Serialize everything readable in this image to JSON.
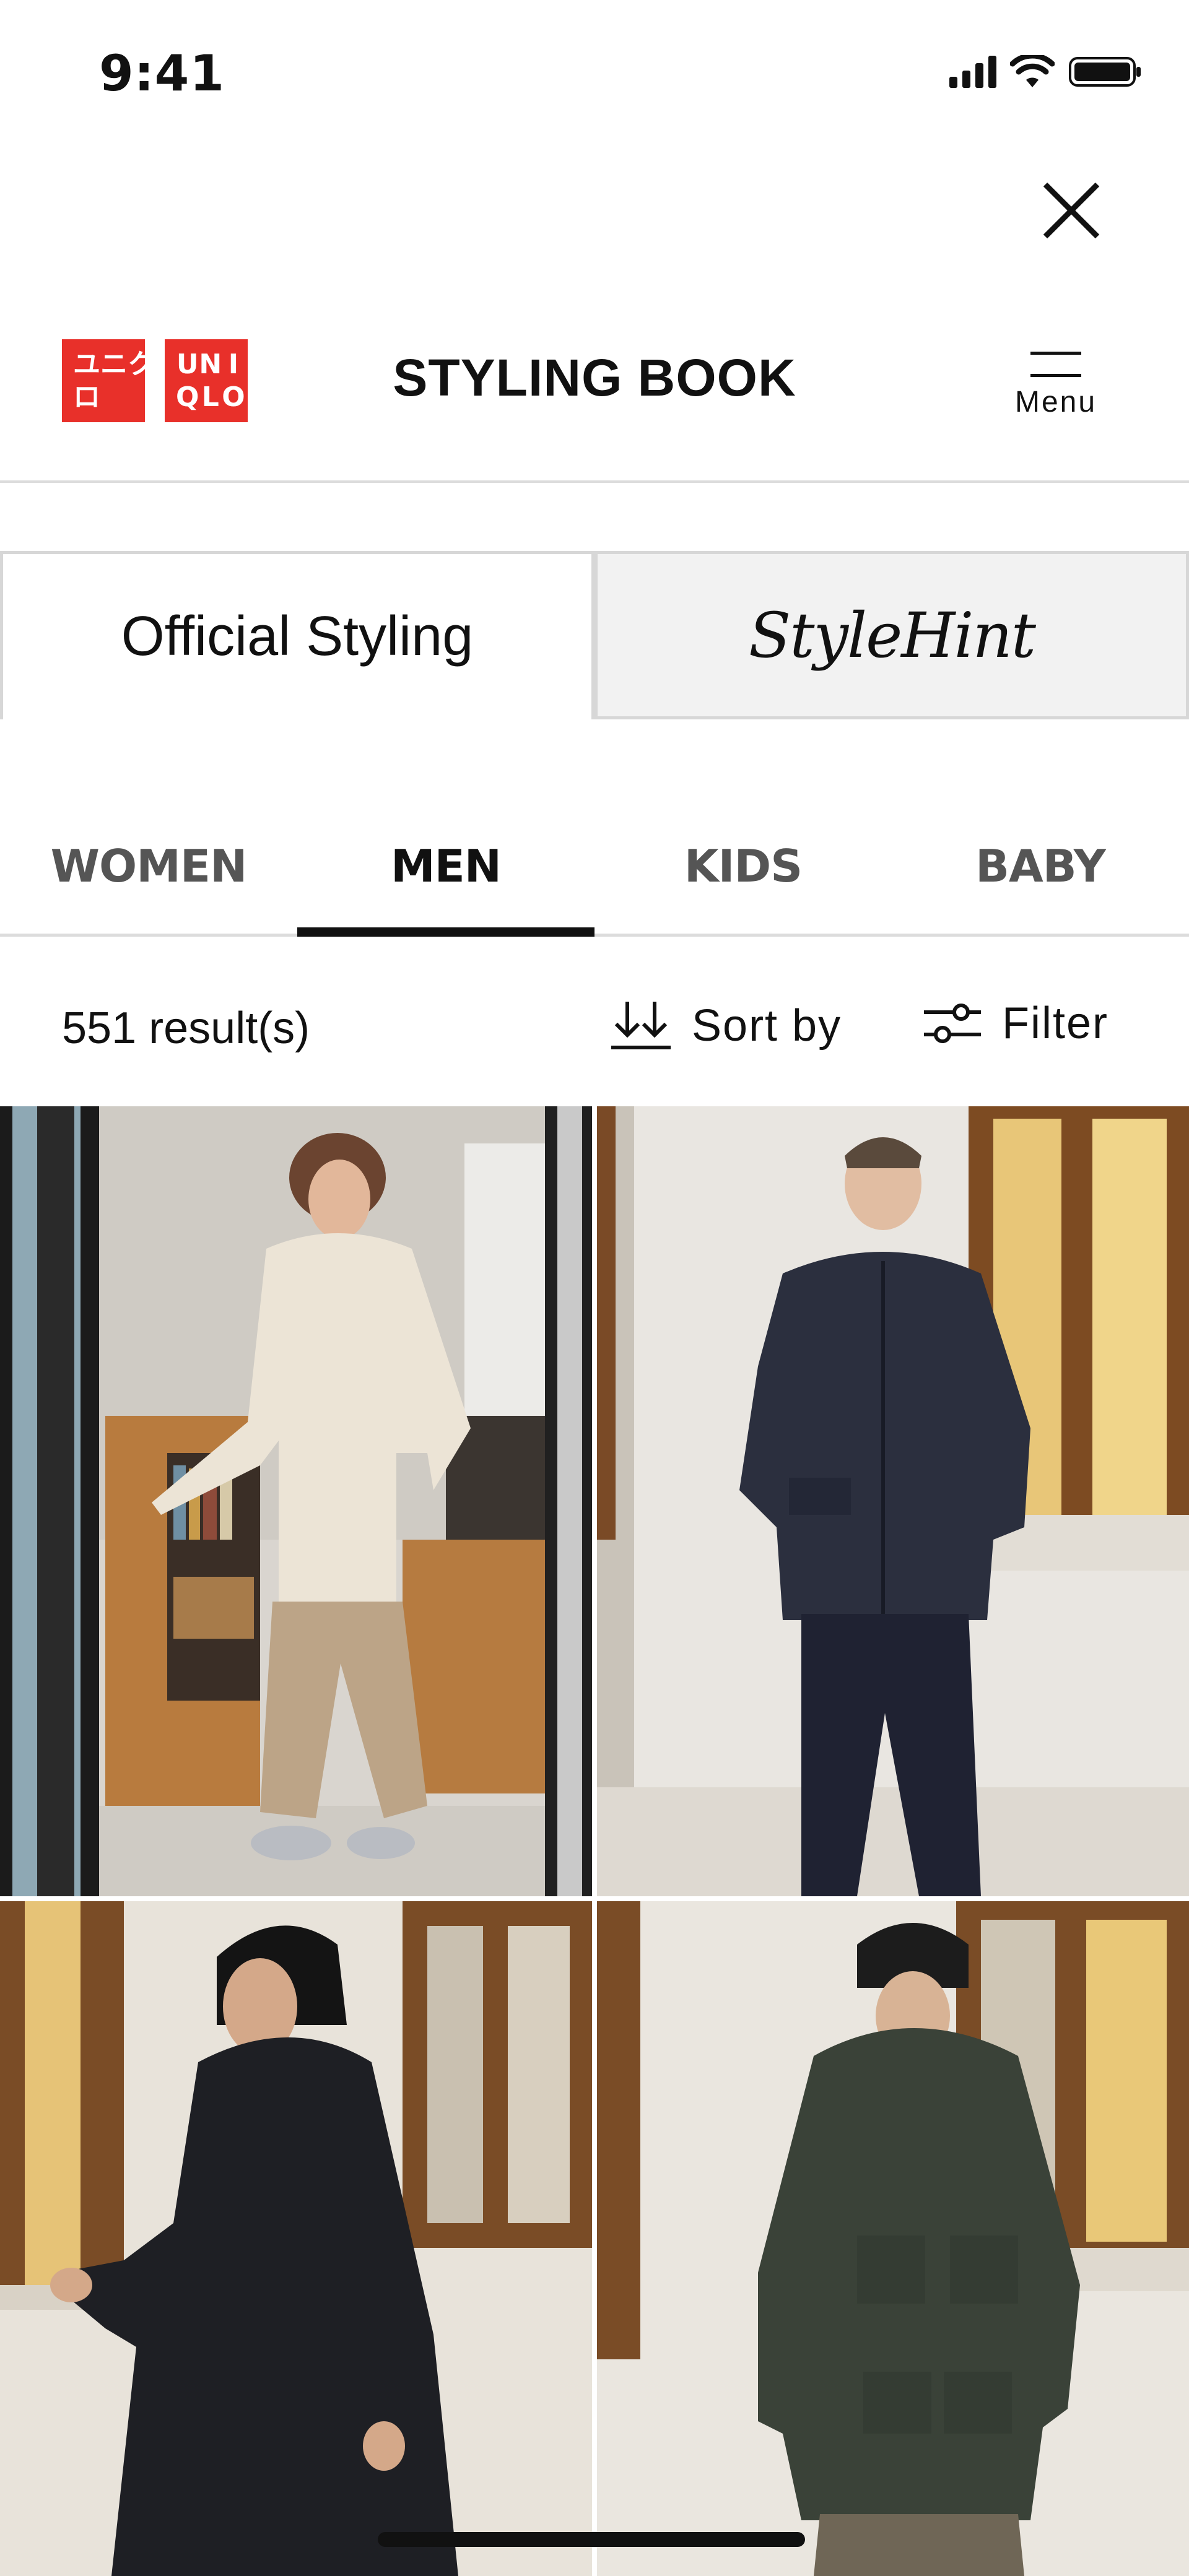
{
  "status_bar": {
    "time": "9:41"
  },
  "header": {
    "logo_top": [
      "ユ",
      "ニ",
      "ク",
      "U",
      "N",
      "I"
    ],
    "logo_bottom": [
      "ロ",
      "",
      "",
      "Q",
      "L",
      "O"
    ],
    "title": "STYLING BOOK",
    "menu_label": "Menu"
  },
  "type_tabs": [
    {
      "label": "Official Styling",
      "active": true
    },
    {
      "label": "StyleHint",
      "active": false
    }
  ],
  "gender_tabs": [
    {
      "label": "WOMEN",
      "active": false
    },
    {
      "label": "MEN",
      "active": true
    },
    {
      "label": "KIDS",
      "active": false
    },
    {
      "label": "BABY",
      "active": false
    }
  ],
  "results": {
    "count": "551 result(s)",
    "sort_label": "Sort by",
    "filter_label": "Filter"
  },
  "photos": [
    {
      "subject": "man in cream half-zip sweater and beige cargo pants in a library"
    },
    {
      "subject": "man in dark navy bomber jacket by a window"
    },
    {
      "subject": "man in long black hooded coat leaning on window"
    },
    {
      "subject": "man in dark green parka with knit beanie"
    }
  ],
  "colors": {
    "brand_red": "#e8302a",
    "text": "#111111",
    "divider": "#dcdcdc"
  }
}
